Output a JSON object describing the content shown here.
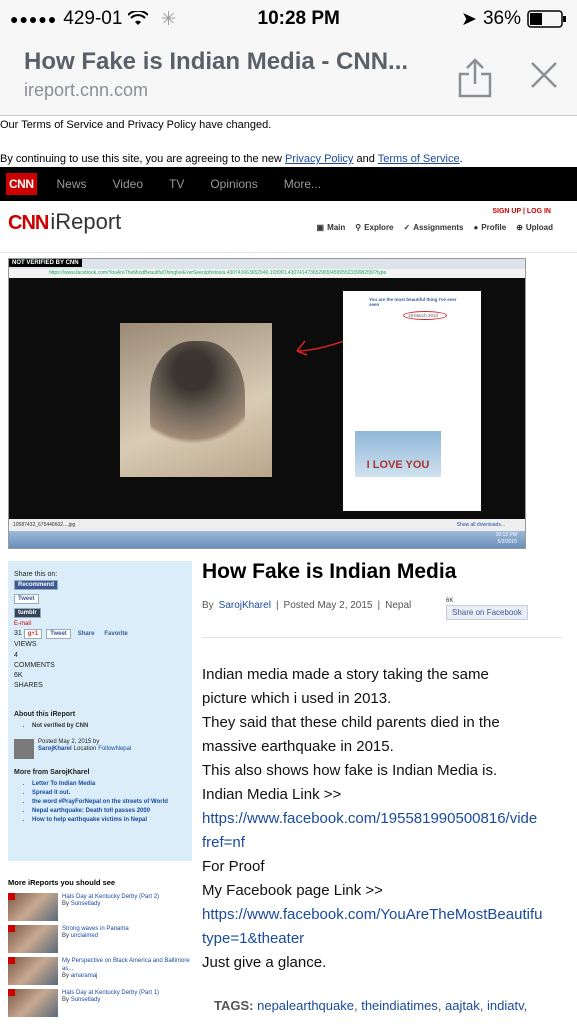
{
  "status": {
    "carrier": "429-01",
    "time": "10:28 PM",
    "battery": "36%"
  },
  "browser": {
    "title": "How Fake is Indian Media - CNN...",
    "domain": "ireport.cnn.com"
  },
  "notice": {
    "line1": "Our Terms of Service and Privacy Policy have changed.",
    "line2_prefix": "By continuing to use this site, you are agreeing to the new ",
    "privacy_link": "Privacy Policy",
    "and": " and ",
    "terms_link": "Terms of Service",
    "period": "."
  },
  "cnn_nav": {
    "logo": "CNN",
    "items": [
      "News",
      "Video",
      "TV",
      "Opinions",
      "More..."
    ]
  },
  "ireport": {
    "logo_cnn": "CNN",
    "logo_text": "iReport",
    "signup": "SIGN UP | LOG IN",
    "nav": [
      "Main",
      "Explore",
      "Assignments",
      "Profile",
      "Upload"
    ]
  },
  "hero": {
    "not_verified": "NOT VERIFIED BY CNN",
    "url": "https://www.facebook.com/YouAreTheMostBeautifulThingIveEverSeen/photos/a.430741663652946.103991.430741473652965/459955233998255/?type",
    "fb_caption": "You are the most beautiful thing I've ever seen",
    "fb_date": "19 March 2013",
    "i_love_you": "I LOVE YOU",
    "download": "10587432_675446602....jpg",
    "show_downloads": "Show all downloads...",
    "clock_time": "10:12 PM",
    "clock_date": "5/2/2015"
  },
  "sidebar": {
    "share_this_on": "Share this on:",
    "recommend": "Recommend",
    "tweet": "Tweet",
    "tumblr": "tumblr",
    "email": "E-mail",
    "count_31": "31",
    "gplus": "g+1",
    "tweet2": "Tweet",
    "share": "Share",
    "favorite": "Favorite",
    "views_label": "VIEWS",
    "comments_count": "4",
    "comments_label": "COMMENTS",
    "shares_count": "6K",
    "shares_label": "SHARES",
    "about_title": "About this iReport",
    "not_verified": "Not verified by CNN",
    "posted": "Posted May 2, 2015 by",
    "author": "SarojKharel",
    "location_label": "Location",
    "location": "FollowNepal",
    "more_from": "More from SarojKharel",
    "links": [
      "Letter To Indian Media",
      "Spread it out.",
      "the word #PrayForNepal on the streets of World",
      "Nepal earthquake: Death toll passes 2000",
      "How to help earthquake victims in Nepal"
    ]
  },
  "more_ireports": {
    "title": "More iReports you should see",
    "items": [
      {
        "title": "Hats Day at Kentucky Derby (Part 2)",
        "by": "By",
        "author": "Sunsetlady"
      },
      {
        "title": "Strong waves in Panama",
        "by": "By",
        "author": "unclaimed"
      },
      {
        "title": "My Perspective on Black America and Baltimore as...",
        "by": "By",
        "author": "amaramaj"
      },
      {
        "title": "Hats Day at Kentucky Derby (Part 1)",
        "by": "By",
        "author": "Sunsetlady"
      }
    ]
  },
  "article": {
    "title": "How Fake is Indian Media",
    "by": "By",
    "author": "SarojKharel",
    "posted": "Posted May 2, 2015",
    "location": "Nepal",
    "fb_count": "6K",
    "fb_share": "Share on Facebook",
    "lines": [
      {
        "text": "Indian media made a story taking the same",
        "link": false
      },
      {
        "text": "picture which i used in 2013.",
        "link": false
      },
      {
        "text": "They said that these child parents died in the",
        "link": false
      },
      {
        "text": "massive earthquake in 2015.",
        "link": false
      },
      {
        "text": "This also shows how fake is Indian Media is.",
        "link": false
      },
      {
        "text": "Indian Media Link >>",
        "link": false
      },
      {
        "text": "https://www.facebook.com/195581990500816/vide",
        "link": true
      },
      {
        "text": "fref=nf",
        "link": true
      },
      {
        "text": "For Proof",
        "link": false
      },
      {
        "text": "My Facebook page Link >>",
        "link": false
      },
      {
        "text": "https://www.facebook.com/YouAreTheMostBeautifu",
        "link": true
      },
      {
        "text": "type=1&theater",
        "link": true
      },
      {
        "text": "Just give a glance.",
        "link": false
      }
    ],
    "tags_label": "TAGS:",
    "tags": [
      "nepalearthquake",
      "theindiatimes",
      "aajtak",
      "indiatv"
    ]
  },
  "colors": {
    "cnn_red": "#cc0000",
    "link": "#1a4a9c",
    "sidebar_bg": "#daedf8"
  }
}
